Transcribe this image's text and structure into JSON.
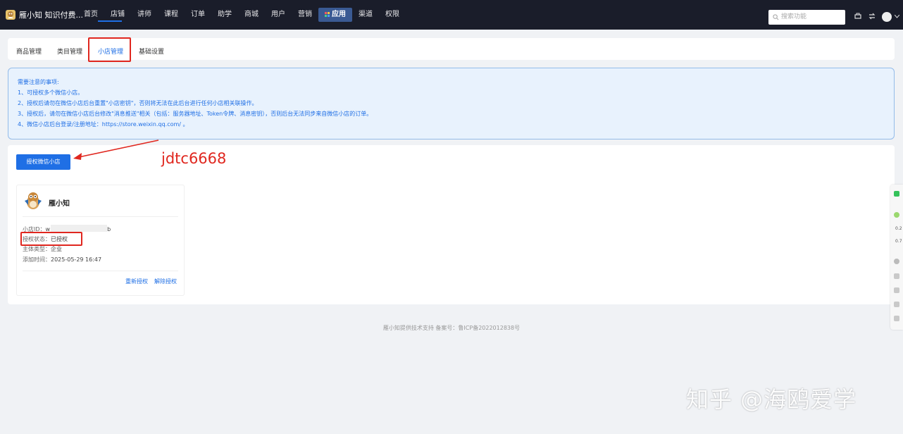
{
  "nav": {
    "brand": "雁小知 知识付费...",
    "items": [
      "首页",
      "店铺",
      "讲师",
      "课程",
      "订单",
      "助学",
      "商城",
      "用户",
      "营销",
      "应用",
      "渠道",
      "权限"
    ],
    "active": "应用",
    "search_placeholder": "搜索功能"
  },
  "tabs": [
    "商品管理",
    "类目管理",
    "小店管理",
    "基础设置"
  ],
  "notice": {
    "title": "需要注意的事项:",
    "lines": [
      "1、可授权多个微信小店。",
      "2、授权后请勿在微信小店后台重置\"小店密钥\"，否则将无法在此后台进行任何小店相关联操作。",
      "3、授权后，请勿在微信小店后台修改\"消息推送\"相关（包括：服务器地址、Token令牌、消息密钥），否则后台无法同步来自微信小店的订单。",
      "4、微信小店后台登录/注册地址：https://store.weixin.qq.com/ 。"
    ]
  },
  "auth_button": "授权微信小店",
  "annotation": "jdtc6668",
  "shop": {
    "name": "雁小知",
    "id_label": "小店ID：",
    "id_prefix": "w",
    "id_suffix": "b",
    "status_label": "授权状态：",
    "status_value": "已授权",
    "entity_label": "主体类型：",
    "entity_value": "企业",
    "added_label": "添加时间：",
    "added_value": "2025-05-29 16:47",
    "reauth": "重新授权",
    "revoke": "解除授权"
  },
  "footer": "雁小知提供技术支持   备案号：鲁ICP备2022012838号",
  "side_tools": {
    "num1": "0.2",
    "num2": "0.7"
  },
  "watermark": "知乎 @海鸥爱学",
  "colors": {
    "primary": "#1f6fe5",
    "annotation": "#e0271f",
    "topbar": "#1a1d2a"
  }
}
